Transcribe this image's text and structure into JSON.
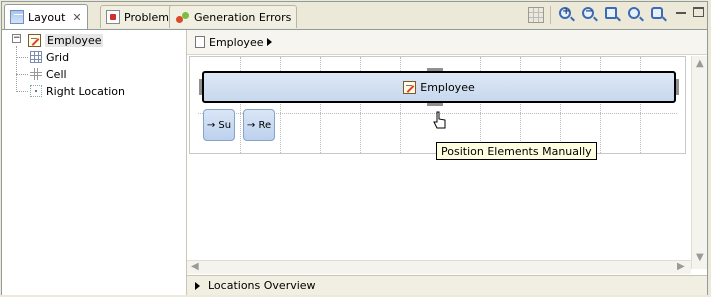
{
  "tabs": [
    {
      "label": "Layout",
      "icon": "layout-icon",
      "active": true
    },
    {
      "label": "Problems",
      "icon": "problems-icon",
      "active": false
    },
    {
      "label": "Generation Errors",
      "icon": "generation-errors-icon",
      "active": false
    }
  ],
  "toolbar": {
    "icons": [
      "grid-toggle-icon",
      "zoom-in-icon",
      "zoom-out-icon",
      "zoom-fit-icon",
      "zoom-selection-icon",
      "zoom-page-icon",
      "minimize-icon",
      "maximize-icon"
    ]
  },
  "tree": {
    "root": {
      "label": "Employee",
      "icon": "employee-form-icon",
      "expanded": true
    },
    "children": [
      {
        "label": "Grid",
        "icon": "grid-icon"
      },
      {
        "label": "Cell",
        "icon": "cell-icon"
      },
      {
        "label": "Right Location",
        "icon": "location-icon"
      }
    ]
  },
  "breadcrumb": {
    "label": "Employee"
  },
  "canvas": {
    "selected_element": "Employee",
    "buttons": [
      "→ Su",
      "→ Re"
    ],
    "tooltip": "Position Elements Manually"
  },
  "footer": {
    "label": "Locations Overview"
  },
  "colors": {
    "selection": "#c7d8ee",
    "tooltip_bg": "#ffffe1",
    "chrome": "#ece9d8"
  }
}
